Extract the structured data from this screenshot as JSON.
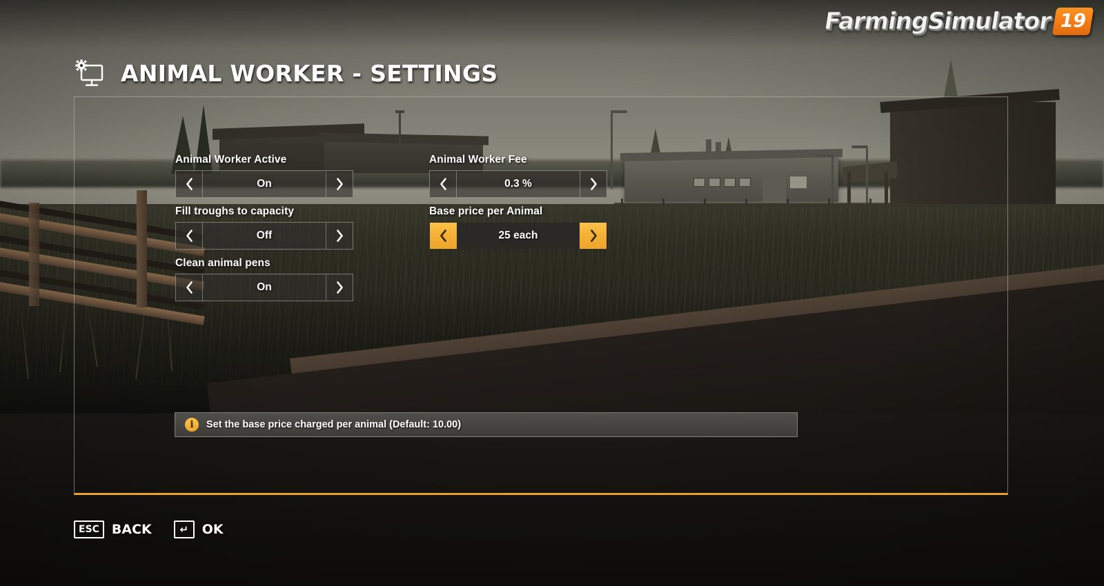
{
  "logo": {
    "word": "FarmingSimulator",
    "edition": "19"
  },
  "header": {
    "title": "ANIMAL WORKER - SETTINGS",
    "icon": "monitor-gear-icon"
  },
  "settings": {
    "left_column": [
      {
        "label": "Animal Worker Active",
        "value": "On",
        "selected": false
      },
      {
        "label": "Fill troughs to capacity",
        "value": "Off",
        "selected": false
      },
      {
        "label": "Clean animal pens",
        "value": "On",
        "selected": false
      }
    ],
    "right_column": [
      {
        "label": "Animal Worker Fee",
        "value": "0.3 %",
        "selected": false
      },
      {
        "label": "Base price per Animal",
        "value": "25 each",
        "selected": true
      }
    ]
  },
  "help": {
    "icon": "info-icon",
    "glyph": "i",
    "text": "Set the base price charged per animal (Default: 10.00)"
  },
  "footer": {
    "buttons": [
      {
        "key": "ESC",
        "label": "BACK"
      },
      {
        "key": "↵",
        "label": "OK"
      }
    ]
  },
  "colors": {
    "accent": "#e8a227",
    "selected_button": "#f5b035",
    "panel_border": "#bebeb9",
    "text": "#ffffff",
    "badge_orange": "#f47a16"
  }
}
